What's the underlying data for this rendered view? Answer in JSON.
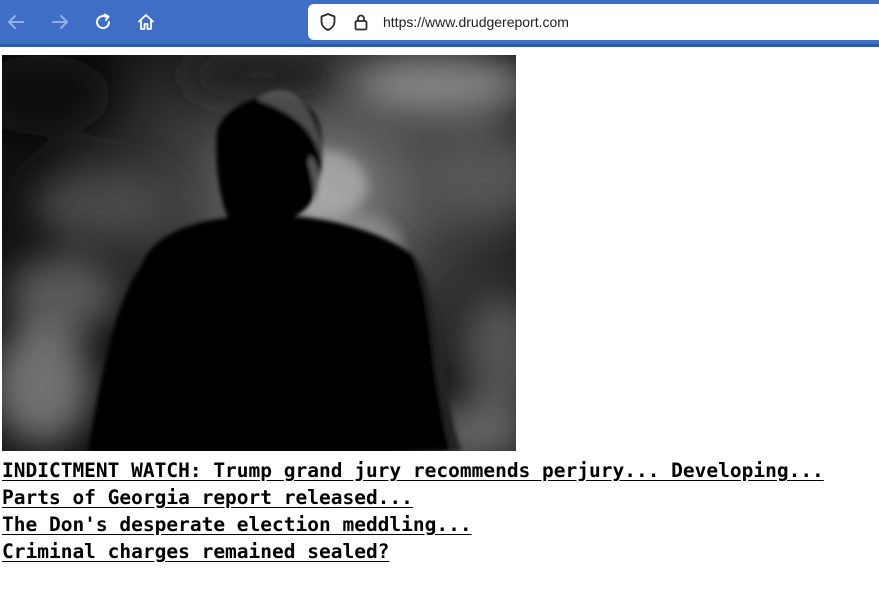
{
  "browser": {
    "url": "https://www.drudgereport.com",
    "icons": {
      "back": "back-arrow-icon",
      "forward": "forward-arrow-icon",
      "reload": "reload-icon",
      "home": "home-icon",
      "tracking": "shield-icon",
      "security": "lock-icon"
    },
    "colors": {
      "toolbar": "#3f6ec6",
      "urlbar": "#ffffff"
    }
  },
  "page": {
    "photo": {
      "subject": "silhouette of man from behind against dark clouds",
      "style": "black-and-white"
    },
    "headlines": [
      "INDICTMENT WATCH: Trump grand jury recommends perjury... Developing...",
      "Parts of Georgia report released...",
      "The Don's desperate election meddling...",
      "Criminal charges remained sealed?"
    ]
  }
}
